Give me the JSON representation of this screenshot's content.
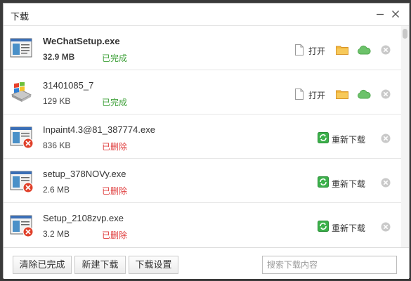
{
  "window": {
    "title": "下载"
  },
  "downloads": [
    {
      "name": "WeChatSetup.exe",
      "size": "32.9 MB",
      "status": "已完成",
      "state": "completed",
      "icon": "exe-file-icon",
      "open_label": "打开"
    },
    {
      "name": "31401085_7",
      "size": "129 KB",
      "status": "已完成",
      "state": "completed",
      "icon": "windows-installer-icon",
      "open_label": "打开"
    },
    {
      "name": "Inpaint4.3@81_387774.exe",
      "size": "836 KB",
      "status": "已删除",
      "state": "deleted",
      "icon": "exe-file-deleted-icon",
      "redownload_label": "重新下载"
    },
    {
      "name": "setup_378NOVy.exe",
      "size": "2.6 MB",
      "status": "已删除",
      "state": "deleted",
      "icon": "exe-file-deleted-icon",
      "redownload_label": "重新下载"
    },
    {
      "name": "Setup_2108zvp.exe",
      "size": "3.2 MB",
      "status": "已删除",
      "state": "deleted",
      "icon": "exe-file-deleted-icon",
      "redownload_label": "重新下载"
    }
  ],
  "footer": {
    "clear_completed": "清除已完成",
    "new_download": "新建下载",
    "download_settings": "下载设置",
    "search_placeholder": "搜索下载内容"
  },
  "colors": {
    "completed": "#3fa13a",
    "deleted": "#e04040",
    "redownload_icon": "#3bb04a",
    "cloud": "#6cc26a",
    "folder": "#f2b63a"
  }
}
